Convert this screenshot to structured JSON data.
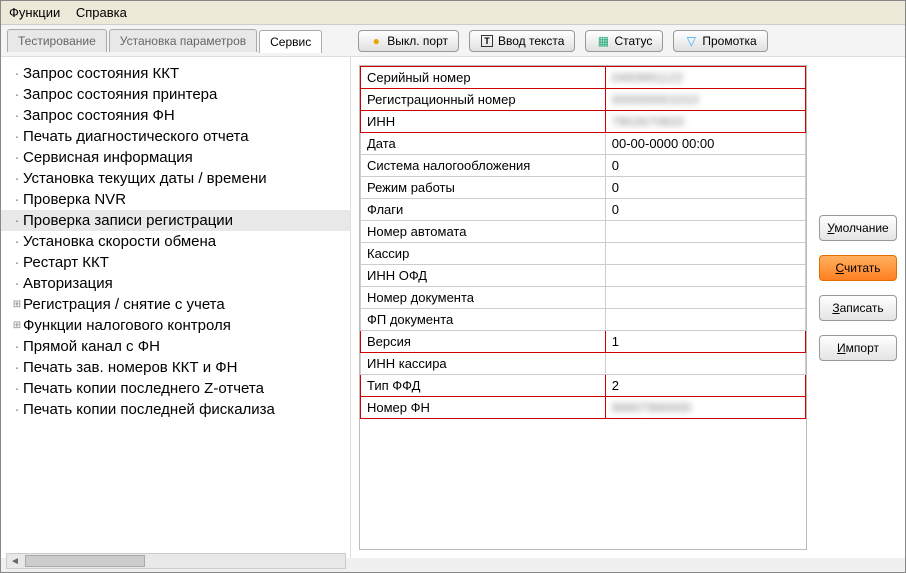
{
  "menu": {
    "functions": "Функции",
    "help": "Справка"
  },
  "tabs": {
    "testing": "Тестирование",
    "params": "Установка параметров",
    "service": "Сервис"
  },
  "toolbar": {
    "port_off": "Выкл. порт",
    "text_input": "Ввод текста",
    "status": "Статус",
    "rewind": "Промотка"
  },
  "sidebar": {
    "items": [
      "Запрос состояния ККТ",
      "Запрос состояния принтера",
      "Запрос состояния ФН",
      "Печать диагностического отчета",
      "Сервисная информация",
      "Установка текущих даты / времени",
      "Проверка NVR",
      "Проверка записи регистрации",
      "Установка скорости обмена",
      "Рестарт ККТ",
      "Авторизация",
      "Регистрация / снятие с учета",
      "Функции налогового контроля",
      "Прямой канал с ФН",
      "Печать зав. номеров ККТ и ФН",
      "Печать копии последнего Z-отчета",
      "Печать копии последней фискализа"
    ],
    "selected": 7,
    "expandable": [
      11,
      12
    ]
  },
  "grid": [
    {
      "label": "Серийный номер",
      "value": "0493991122",
      "blur": true,
      "red": true
    },
    {
      "label": "Регистрационный номер",
      "value": "000000001010",
      "blur": true,
      "red": true
    },
    {
      "label": "ИНН",
      "value": "7802670820",
      "blur": true,
      "red": true
    },
    {
      "label": "Дата",
      "value": "00-00-0000 00:00"
    },
    {
      "label": "Система налогообложения",
      "value": "0"
    },
    {
      "label": "Режим работы",
      "value": "0"
    },
    {
      "label": "Флаги",
      "value": "0"
    },
    {
      "label": "Номер автомата",
      "value": ""
    },
    {
      "label": "Кассир",
      "value": ""
    },
    {
      "label": "ИНН ОФД",
      "value": ""
    },
    {
      "label": "Номер документа",
      "value": ""
    },
    {
      "label": "ФП документа",
      "value": ""
    },
    {
      "label": "Версия",
      "value": "1",
      "red": true
    },
    {
      "label": "ИНН кассира",
      "value": ""
    },
    {
      "label": "Тип ФФД",
      "value": "2",
      "red": true
    },
    {
      "label": "Номер ФН",
      "value": "99907890000",
      "blur": true,
      "red": true
    }
  ],
  "buttons": {
    "default": "Умолчание",
    "read": "Считать",
    "write": "Записать",
    "import": "Импорт"
  }
}
